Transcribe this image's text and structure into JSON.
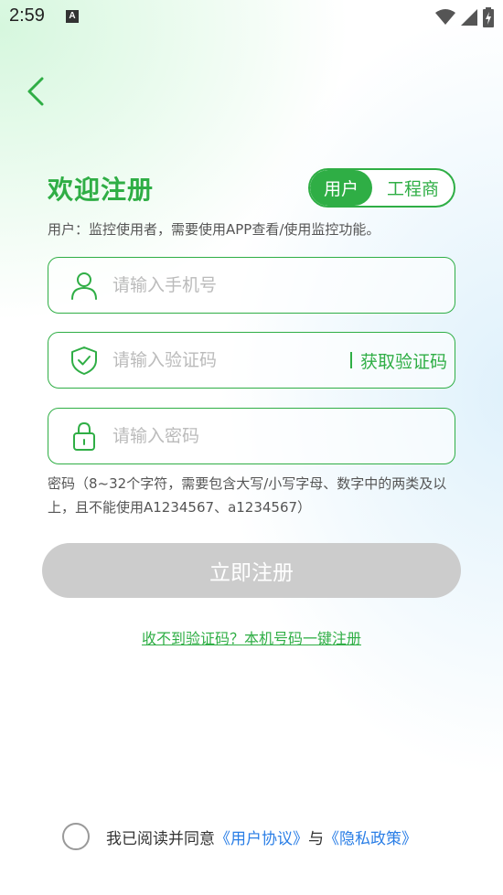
{
  "status_bar": {
    "time": "2:59",
    "notification_glyph": "A"
  },
  "header": {
    "back_icon": "chevron-left-icon"
  },
  "page": {
    "title": "欢迎注册",
    "segment": {
      "user_label": "用户",
      "engineer_label": "工程商",
      "selected": "用户"
    },
    "subtitle": "用户：监控使用者，需要使用APP查看/使用监控功能。"
  },
  "form": {
    "phone": {
      "placeholder": "请输入手机号",
      "value": "",
      "icon": "user-icon"
    },
    "code": {
      "placeholder": "请输入验证码",
      "value": "",
      "icon": "shield-check-icon",
      "get_code_label": "获取验证码"
    },
    "password": {
      "placeholder": "请输入密码",
      "value": "",
      "icon": "lock-icon"
    },
    "password_hint": "密码（8~32个字符，需要包含大写/小写字母、数字中的两类及以上，且不能使用A1234567、a1234567）"
  },
  "register_button": {
    "label": "立即注册"
  },
  "one_click_link": "收不到验证码？本机号码一键注册",
  "agreement": {
    "prefix": "我已阅读并同意",
    "user_agreement": "《用户协议》",
    "and": "与",
    "privacy_policy": "《隐私政策》",
    "checked": false
  },
  "colors": {
    "accent": "#2fae45",
    "link": "#2a7ee6",
    "button_disabled": "#cccccc"
  }
}
